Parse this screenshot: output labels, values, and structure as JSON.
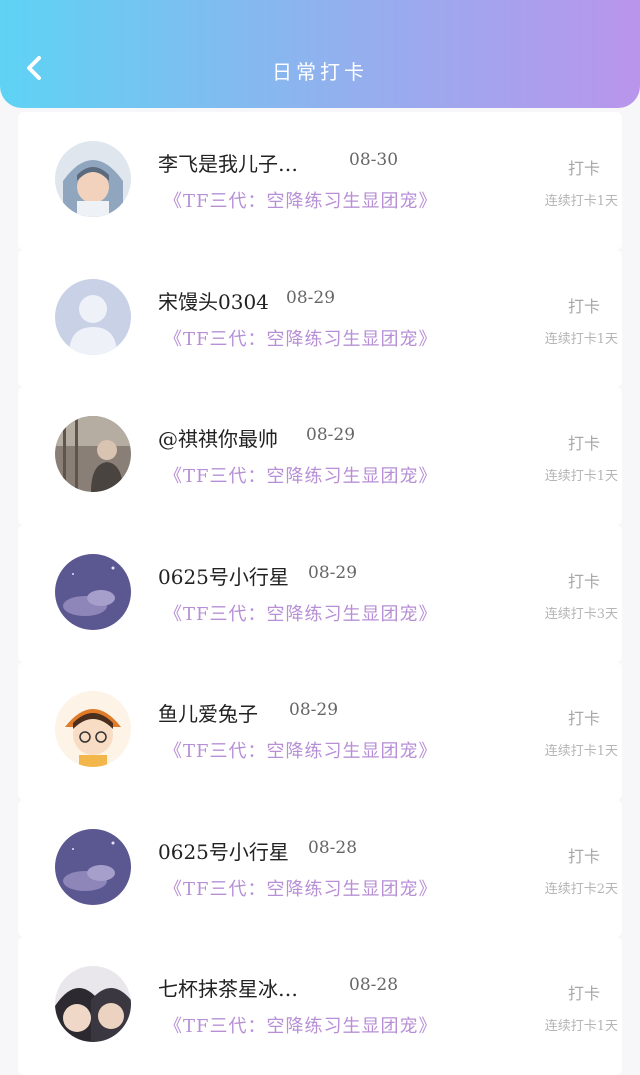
{
  "header": {
    "title": "日常打卡",
    "back_icon": "chevron-left-icon"
  },
  "items": [
    {
      "name": "李飞是我儿子…",
      "date": "08-30",
      "group": "《TF三代：空降练习生显团宠》",
      "checkin_label": "打卡",
      "streak": "连续打卡1天"
    },
    {
      "name": "宋馒头0304",
      "date": "08-29",
      "group": "《TF三代：空降练习生显团宠》",
      "checkin_label": "打卡",
      "streak": "连续打卡1天"
    },
    {
      "name": "@祺祺你最帅",
      "date": "08-29",
      "group": "《TF三代：空降练习生显团宠》",
      "checkin_label": "打卡",
      "streak": "连续打卡1天"
    },
    {
      "name": "0625号小行星",
      "date": "08-29",
      "group": "《TF三代：空降练习生显团宠》",
      "checkin_label": "打卡",
      "streak": "连续打卡3天"
    },
    {
      "name": "鱼儿爱兔子",
      "date": "08-29",
      "group": "《TF三代：空降练习生显团宠》",
      "checkin_label": "打卡",
      "streak": "连续打卡1天"
    },
    {
      "name": "0625号小行星",
      "date": "08-28",
      "group": "《TF三代：空降练习生显团宠》",
      "checkin_label": "打卡",
      "streak": "连续打卡2天"
    },
    {
      "name": "七杯抹茶星冰…",
      "date": "08-28",
      "group": "《TF三代：空降练习生显团宠》",
      "checkin_label": "打卡",
      "streak": "连续打卡1天"
    }
  ],
  "colors": {
    "header_gradient_start": "#5ed3f4",
    "header_gradient_end": "#b995ec",
    "group_text": "#b78fd6"
  }
}
